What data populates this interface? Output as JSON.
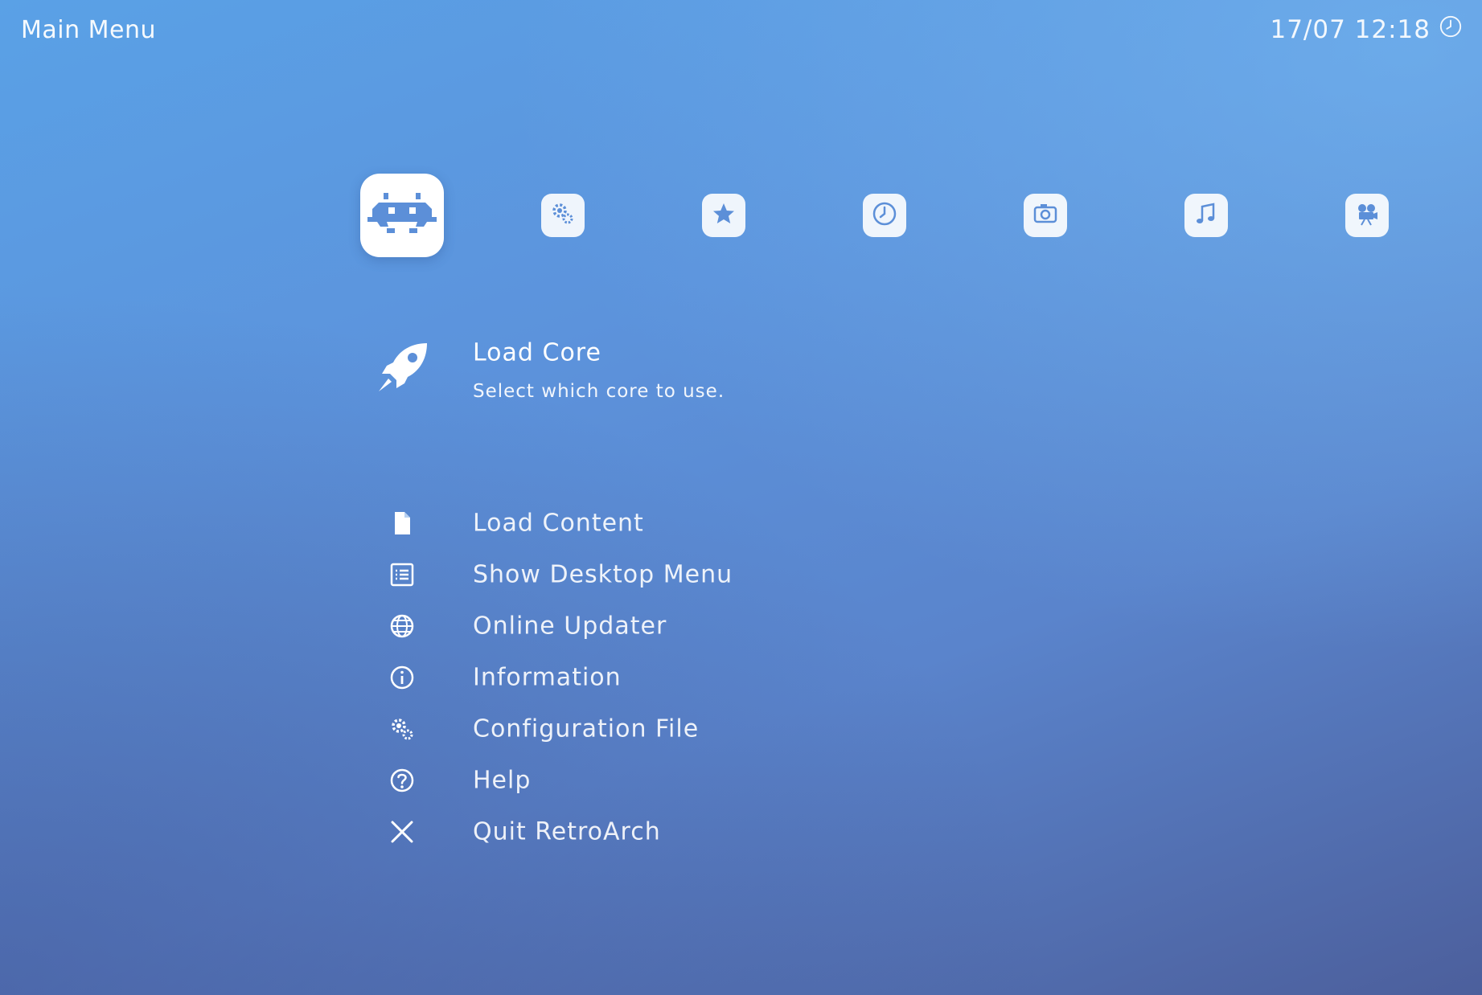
{
  "header": {
    "title": "Main Menu",
    "datetime": "17/07 12:18",
    "clock_icon": "clock-icon"
  },
  "tabs": [
    {
      "name": "main-menu",
      "icon": "retroarch-invader-icon",
      "active": true
    },
    {
      "name": "settings",
      "icon": "settings-gears-icon",
      "active": false
    },
    {
      "name": "favorites",
      "icon": "star-icon",
      "active": false
    },
    {
      "name": "history",
      "icon": "clock-icon",
      "active": false
    },
    {
      "name": "images",
      "icon": "camera-icon",
      "active": false
    },
    {
      "name": "music",
      "icon": "music-note-icon",
      "active": false
    },
    {
      "name": "videos",
      "icon": "video-camera-icon",
      "active": false
    }
  ],
  "menu": {
    "selected": {
      "label": "Load Core",
      "sublabel": "Select which core to use.",
      "icon": "rocket-icon"
    },
    "items": [
      {
        "label": "Load Content",
        "icon": "file-icon"
      },
      {
        "label": "Show Desktop Menu",
        "icon": "list-icon"
      },
      {
        "label": "Online Updater",
        "icon": "globe-icon"
      },
      {
        "label": "Information",
        "icon": "info-icon"
      },
      {
        "label": "Configuration File",
        "icon": "gears-icon"
      },
      {
        "label": "Help",
        "icon": "help-icon"
      },
      {
        "label": "Quit RetroArch",
        "icon": "close-icon"
      }
    ]
  },
  "colors": {
    "bg_top": "#5aa1e6",
    "bg_bottom": "#4c5f9c",
    "icon_fill": "#ffffff",
    "icon_cutout": "#5c8fd8"
  }
}
